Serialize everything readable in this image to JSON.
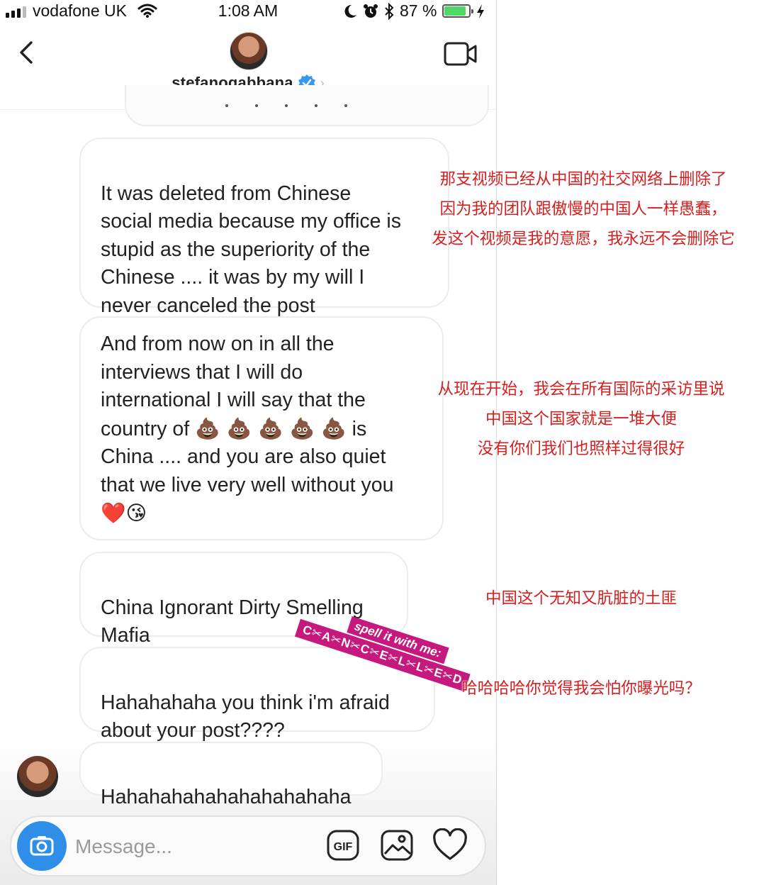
{
  "status_bar": {
    "carrier": "vodafone UK",
    "time": "1:08 AM",
    "battery": "87 %",
    "battery_level": 0.87
  },
  "header": {
    "username": "stefanogabbana",
    "verified": true
  },
  "messages": [
    {
      "text": "It was deleted from Chinese\nsocial media because my office is\nstupid as the superiority of the\nChinese .... it was by my will I\nnever canceled the post"
    },
    {
      "text": "And from now on in all the\ninterviews that I will do\ninternational I will say that the\ncountry of",
      "emojis_inline": "💩 💩 💩 💩 💩",
      "text_after": "is\nChina .... and you are also quiet\nthat we live very well without you",
      "emojis_end": "❤️😘"
    },
    {
      "text": "China Ignorant Dirty Smelling\nMafia"
    },
    {
      "text": "Hahahahaha you think i'm afraid\nabout your post????"
    },
    {
      "text": "Hahahahahahahahahahaha"
    }
  ],
  "sticker": {
    "line1": "spell it with me:",
    "line2": "C✂A✂N✂C✂E✂L✂L✂E✂D"
  },
  "composer": {
    "placeholder": "Message...",
    "gif_label": "GIF"
  },
  "annotations": [
    "那支视频已经从中国的社交网络上删除了\n因为我的团队跟傲慢的中国人一样愚蠢，\n发这个视频是我的意愿，我永远不会删除它",
    "从现在开始，我会在所有国际的采访里说\n中国这个国家就是一堆大便\n没有你们我们也照样过得很好",
    "中国这个无知又肮脏的土匪",
    "哈哈哈哈你觉得我会怕你曝光吗？"
  ],
  "colors": {
    "accent": "#2f8ee7",
    "annotation_red": "#d42020",
    "sticker_magenta": "#c5197d"
  },
  "icons": [
    "signal-icon",
    "wifi-icon",
    "moon-icon",
    "alarm-icon",
    "bluetooth-icon",
    "battery-icon",
    "charging-icon",
    "back-chevron-icon",
    "verified-icon",
    "video-camera-icon",
    "camera-icon",
    "gif-icon",
    "gallery-icon",
    "heart-icon"
  ]
}
